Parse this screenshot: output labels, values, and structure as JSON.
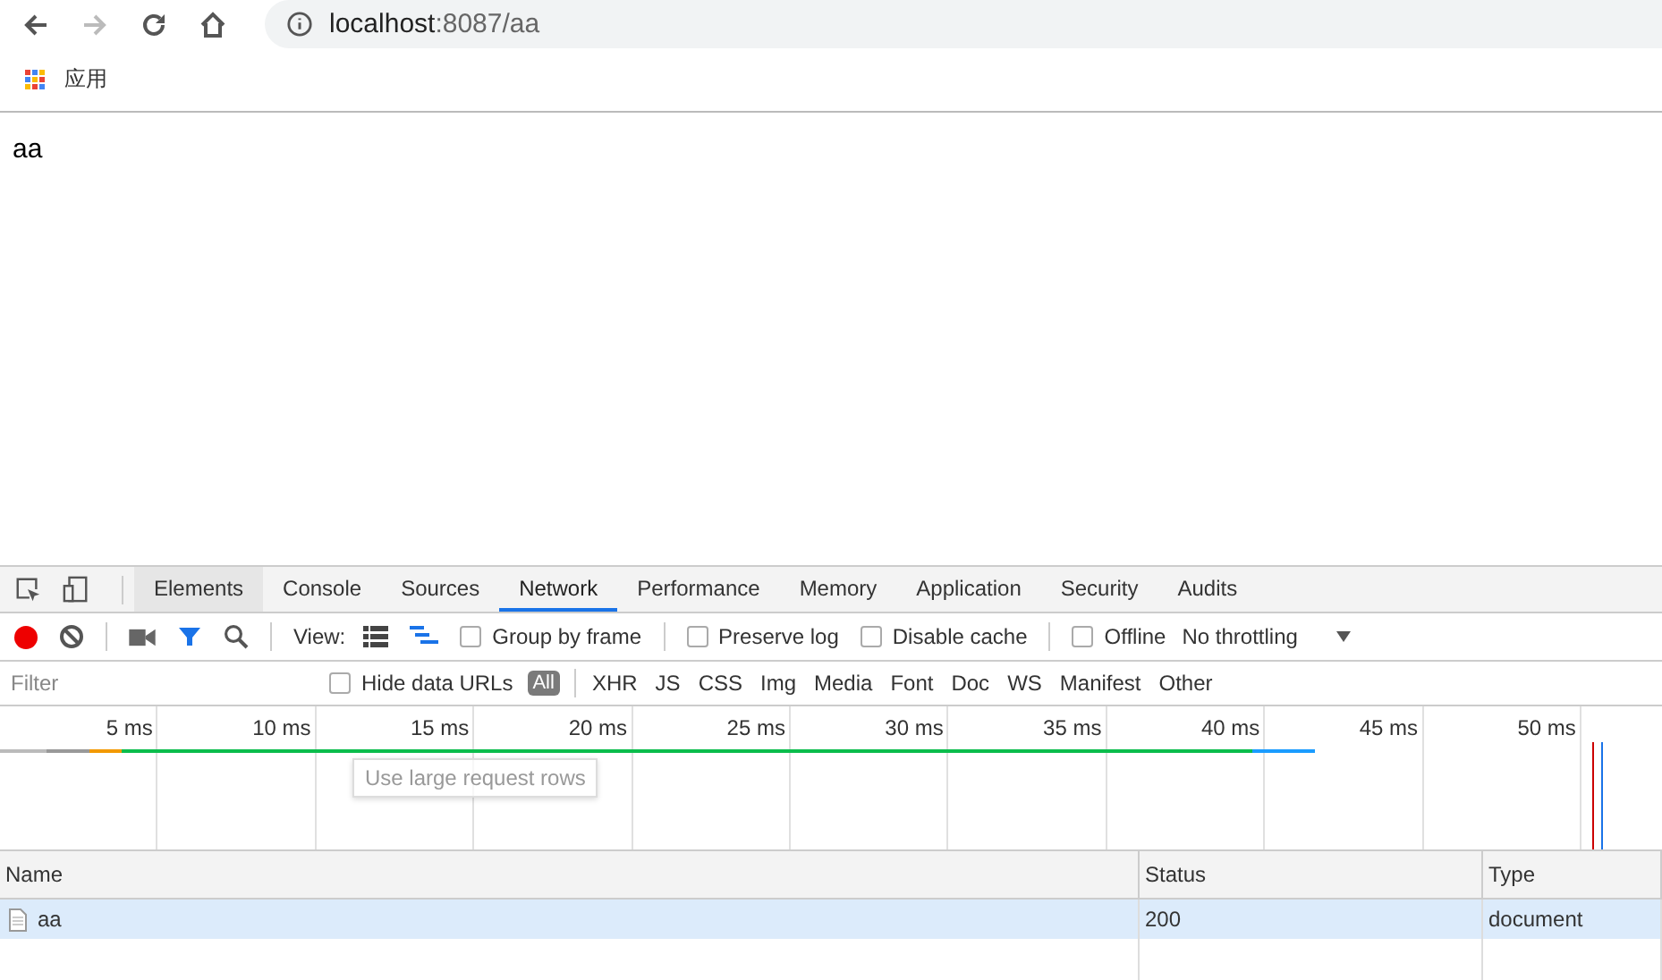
{
  "browser": {
    "address": {
      "host": "localhost",
      "path": ":8087/aa"
    },
    "bookmarks": [
      {
        "label": "应用"
      }
    ]
  },
  "page": {
    "text": "aa"
  },
  "devtools": {
    "tabs": [
      {
        "label": "Elements",
        "selected": false,
        "hovered": true
      },
      {
        "label": "Console",
        "selected": false,
        "hovered": false
      },
      {
        "label": "Sources",
        "selected": false,
        "hovered": false
      },
      {
        "label": "Network",
        "selected": true,
        "hovered": false
      },
      {
        "label": "Performance",
        "selected": false,
        "hovered": false
      },
      {
        "label": "Memory",
        "selected": false,
        "hovered": false
      },
      {
        "label": "Application",
        "selected": false,
        "hovered": false
      },
      {
        "label": "Security",
        "selected": false,
        "hovered": false
      },
      {
        "label": "Audits",
        "selected": false,
        "hovered": false
      }
    ],
    "toolbar": {
      "recording": true,
      "filter_on": true,
      "view_label": "View:",
      "large_rows": false,
      "overview": true,
      "options": [
        {
          "label": "Group by frame",
          "checked": false
        },
        {
          "label": "Preserve log",
          "checked": false
        },
        {
          "label": "Disable cache",
          "checked": false
        },
        {
          "label": "Offline",
          "checked": false
        }
      ],
      "throttling": "No throttling"
    },
    "filter_bar": {
      "placeholder": "Filter",
      "hide_data_urls": {
        "label": "Hide data URLs",
        "checked": false
      },
      "all_label": "All",
      "types": [
        "XHR",
        "JS",
        "CSS",
        "Img",
        "Media",
        "Font",
        "Doc",
        "WS",
        "Manifest",
        "Other"
      ],
      "tooltip": "Use large request rows"
    },
    "timeline": {
      "ticks": [
        "5 ms",
        "10 ms",
        "15 ms",
        "20 ms",
        "25 ms",
        "30 ms",
        "35 ms",
        "40 ms",
        "45 ms",
        "50 ms"
      ]
    },
    "table": {
      "columns": [
        "Name",
        "Status",
        "Type"
      ],
      "rows": [
        {
          "name": "aa",
          "status": "200",
          "type": "document",
          "selected": true
        }
      ]
    }
  }
}
